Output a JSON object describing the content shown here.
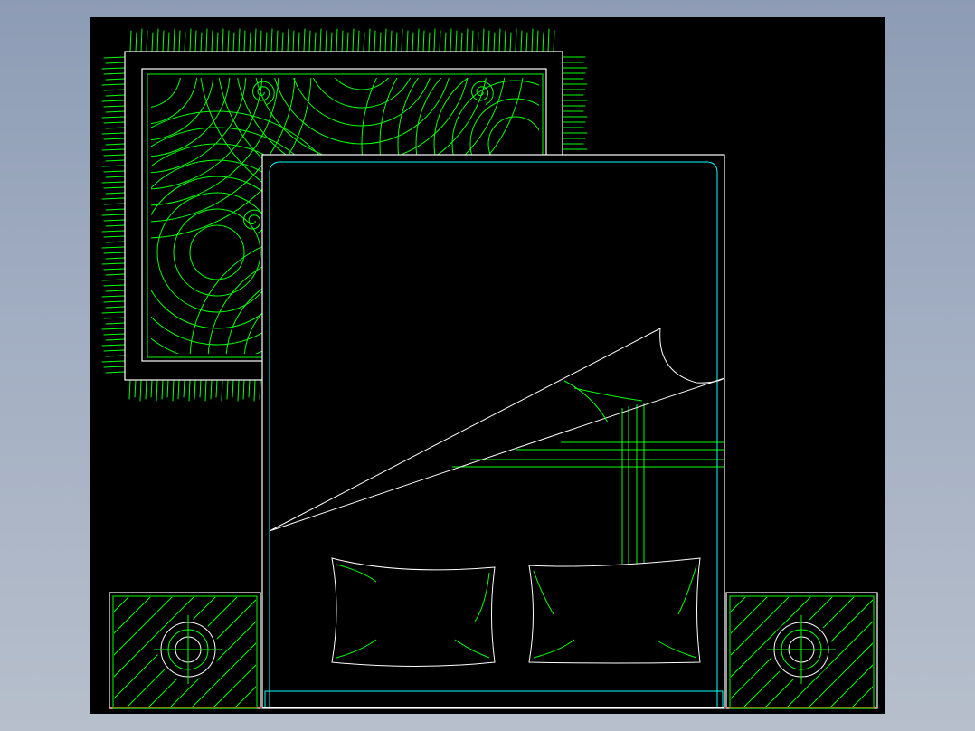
{
  "drawing": {
    "subject": "bedroom-furniture-plan",
    "colors": {
      "outline": "#ffffff",
      "hatch": "#00ff00",
      "trim": "#00ffff",
      "baseline": "#ff0000",
      "background": "#000000",
      "app_frame": "#a3afc3"
    }
  }
}
